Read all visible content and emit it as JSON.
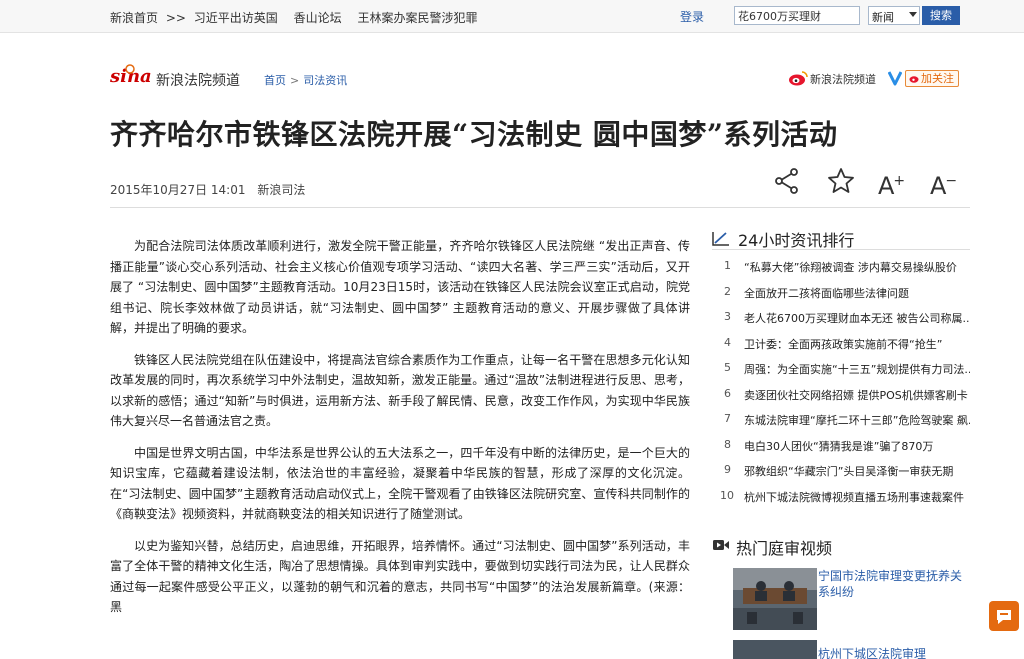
{
  "topbar": {
    "breadcrumb": [
      "新浪首页",
      ">>",
      "习近平出访英国",
      "香山论坛",
      "王林案办案民警涉犯罪"
    ],
    "login_label": "登录",
    "search_value": "花6700万买理财",
    "search_scope": "新闻",
    "search_button": "搜索"
  },
  "channel": {
    "logo_text": "sina",
    "name": "新浪法院频道",
    "crumb_home": "首页",
    "crumb_sep": ">",
    "crumb_section": "司法资讯",
    "weibo_name": "新浪法院频道",
    "follow_label": "加关注"
  },
  "article": {
    "title": "齐齐哈尔市铁锋区法院开展“习法制史 圆中国梦”系列活动",
    "date": "2015年10月27日 14:01",
    "source": "新浪司法",
    "paragraphs": [
      "为配合法院司法体质改革顺利进行，激发全院干警正能量，齐齐哈尔铁锋区人民法院继 “发出正声音、传播正能量”谈心交心系列活动、社会主义核心价值观专项学习活动、“读四大名著、学三严三实”活动后，又开展了 “习法制史、圆中国梦”主题教育活动。10月23日15时，该活动在铁锋区人民法院会议室正式启动，院党组书记、院长李效林做了动员讲话，就“习法制史、圆中国梦” 主题教育活动的意义、开展步骤做了具体讲解，并提出了明确的要求。",
      "铁锋区人民法院党组在队伍建设中，将提高法官综合素质作为工作重点，让每一名干警在思想多元化认知改革发展的同时，再次系统学习中外法制史，温故知新，激发正能量。通过“温故”法制进程进行反思、思考，以求新的感悟；通过“知新”与时俱进，运用新方法、新手段了解民情、民意，改变工作作风，为实现中华民族伟大复兴尽一名普通法官之责。",
      "中国是世界文明古国，中华法系是世界公认的五大法系之一，四千年没有中断的法律历史，是一个巨大的知识宝库，它蕴藏着建设法制，依法治世的丰富经验，凝聚着中华民族的智慧，形成了深厚的文化沉淀。在“习法制史、圆中国梦”主题教育活动启动仪式上，全院干警观看了由铁锋区法院研究室、宣传科共同制作的《商鞅变法》视频资料，并就商鞅变法的相关知识进行了随堂测试。",
      "以史为鉴知兴替，总结历史，启迪思维，开拓眼界，培养情怀。通过“习法制史、圆中国梦”系列活动，丰富了全体干警的精神文化生活，陶冶了思想情操。具体到审判实践中，要做到切实践行司法为民，让人民群众通过每一起案件感受公平正义，以蓬勃的朝气和沉着的意志，共同书写“中国梦”的法治发展新篇章。(来源：黑"
    ]
  },
  "tools": {
    "aplus": "A",
    "aminus": "A",
    "plus_sign": "+",
    "minus_sign": "−"
  },
  "ranking": {
    "title": "24小时资讯排行",
    "items": [
      {
        "num": "1",
        "title": "“私募大佬”徐翔被调查 涉内幕交易操纵股价"
      },
      {
        "num": "2",
        "title": "全面放开二孩将面临哪些法律问题"
      },
      {
        "num": "3",
        "title": "老人花6700万买理财血本无还 被告公司称属..."
      },
      {
        "num": "4",
        "title": "卫计委：全面两孩政策实施前不得“抢生”"
      },
      {
        "num": "5",
        "title": "周强：为全面实施“十三五”规划提供有力司法..."
      },
      {
        "num": "6",
        "title": "卖逐团伙社交网络招嫖 提供POS机供嫖客刷卡"
      },
      {
        "num": "7",
        "title": "东城法院审理“摩托二环十三郎”危险驾驶案 飙..."
      },
      {
        "num": "8",
        "title": "电白30人团伙“猜猜我是谁”骗了870万"
      },
      {
        "num": "9",
        "title": "邪教组织“华藏宗门”头目吴泽衡一审获无期"
      },
      {
        "num": "10",
        "title": "杭州下城法院微博视频直播五场刑事速裁案件"
      }
    ]
  },
  "videos": {
    "title": "热门庭审视频",
    "items": [
      {
        "title": "宁国市法院审理变更抚养关系纠纷"
      },
      {
        "title": "杭州下城区法院审理"
      }
    ]
  },
  "colors": {
    "link": "#2a5da8",
    "accent": "#e46a10",
    "topbar_bg": "#f7f7f7"
  }
}
